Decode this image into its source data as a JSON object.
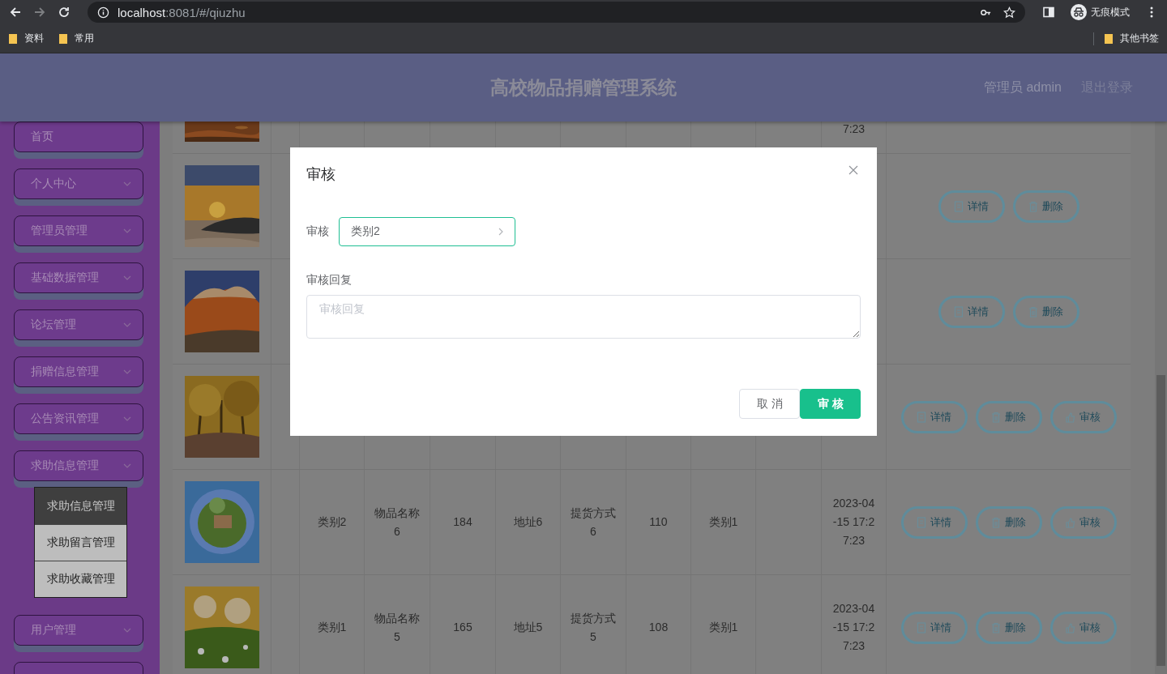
{
  "browser": {
    "url_host": "localhost",
    "url_path": ":8081/#/qiuzhu",
    "forward_disabled": true,
    "profile_label": "无痕模式",
    "bookmarks": [
      {
        "label": "资料"
      },
      {
        "label": "常用"
      }
    ],
    "other_bookmarks": "其他书签"
  },
  "header": {
    "title": "高校物品捐赠管理系统",
    "user": "管理员 admin",
    "logout": "退出登录"
  },
  "sidebar": {
    "items": [
      {
        "label": "首页",
        "has_submenu": false
      },
      {
        "label": "个人中心",
        "has_submenu": true
      },
      {
        "label": "管理员管理",
        "has_submenu": true
      },
      {
        "label": "基础数据管理",
        "has_submenu": true
      },
      {
        "label": "论坛管理",
        "has_submenu": true
      },
      {
        "label": "捐赠信息管理",
        "has_submenu": true
      },
      {
        "label": "公告资讯管理",
        "has_submenu": true
      },
      {
        "label": "求助信息管理",
        "has_submenu": true,
        "children": [
          {
            "label": "求助信息管理",
            "selected": true
          },
          {
            "label": "求助留言管理",
            "selected": false
          },
          {
            "label": "求助收藏管理",
            "selected": false
          }
        ]
      },
      {
        "label": "用户管理",
        "has_submenu": true
      }
    ]
  },
  "table": {
    "rows": [
      {
        "column_11": "7:23"
      },
      {
        "actions": [
          {
            "kind": "detail",
            "label": "详情"
          },
          {
            "kind": "delete",
            "label": "删除"
          }
        ]
      },
      {
        "actions": [
          {
            "kind": "detail",
            "label": "详情"
          },
          {
            "kind": "delete",
            "label": "删除"
          }
        ]
      },
      {
        "actions": [
          {
            "kind": "detail",
            "label": "详情"
          },
          {
            "kind": "delete",
            "label": "删除"
          },
          {
            "kind": "review",
            "label": "审核"
          }
        ]
      },
      {
        "column_3": "类别2",
        "column_4": "物品名称6",
        "column_5": "184",
        "column_6": "地址6",
        "column_7": "提货方式6",
        "column_8": "110",
        "column_9": "类别1",
        "column_11": "2023-04-15 17:27:23",
        "actions": [
          {
            "kind": "detail",
            "label": "详情"
          },
          {
            "kind": "delete",
            "label": "删除"
          },
          {
            "kind": "review",
            "label": "审核"
          }
        ]
      },
      {
        "column_3": "类别1",
        "column_4": "物品名称5",
        "column_5": "165",
        "column_6": "地址5",
        "column_7": "提货方式5",
        "column_8": "108",
        "column_9": "类别1",
        "column_11": "2023-04-15 17:27:23",
        "actions": [
          {
            "kind": "detail",
            "label": "详情"
          },
          {
            "kind": "delete",
            "label": "删除"
          },
          {
            "kind": "review",
            "label": "审核"
          }
        ]
      }
    ]
  },
  "dialog": {
    "title": "审核",
    "fields": [
      {
        "kind": "select",
        "label": "审核",
        "value": "类别2"
      },
      {
        "kind": "textarea",
        "label": "审核回复",
        "placeholder": "审核回复"
      }
    ],
    "buttons": [
      {
        "kind": "default",
        "label": "取消"
      },
      {
        "kind": "primary",
        "label": "审核"
      }
    ]
  }
}
